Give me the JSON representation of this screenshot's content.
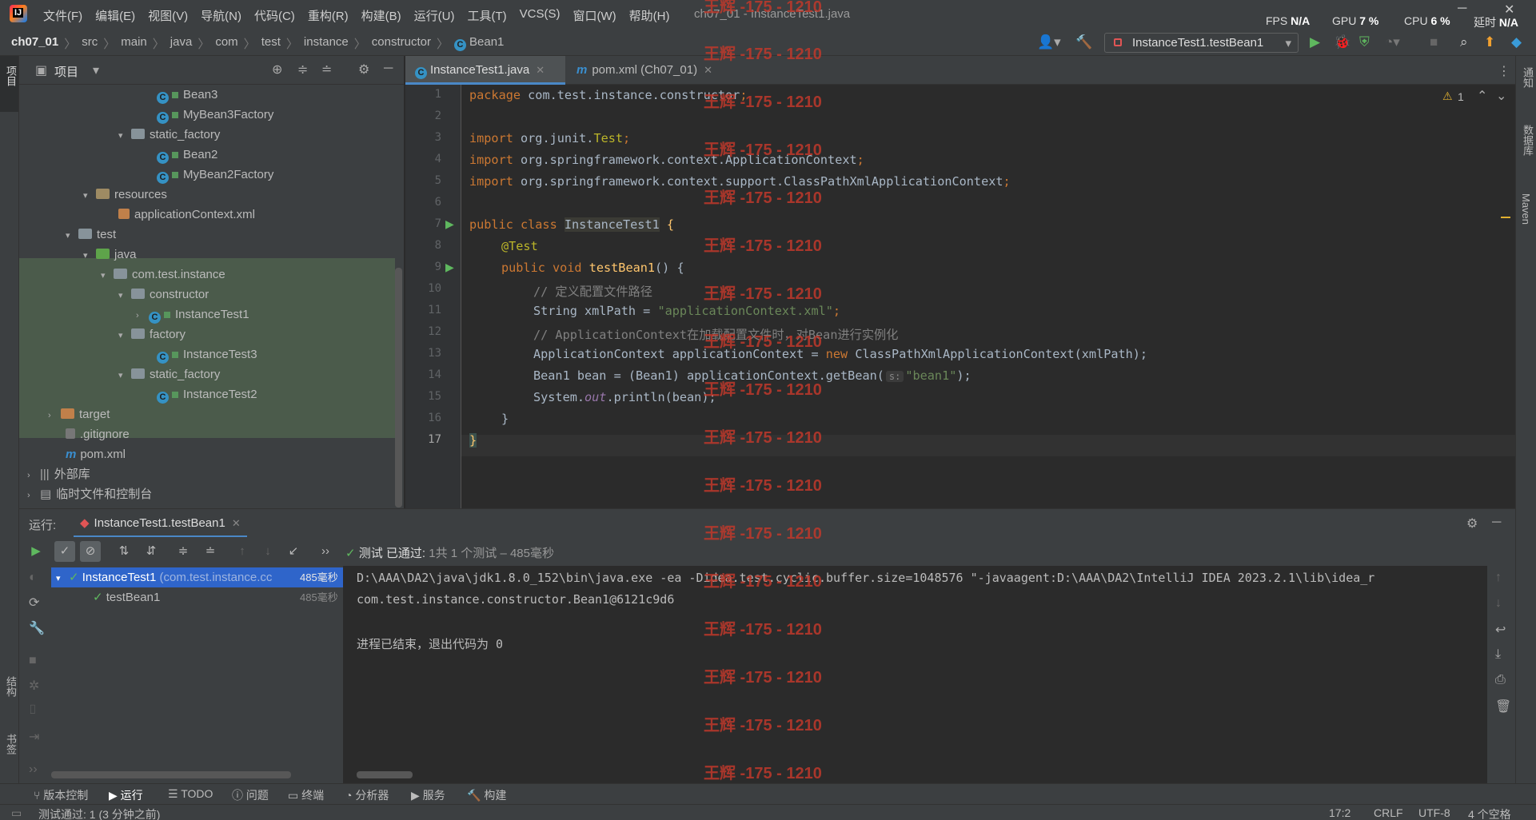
{
  "menu": [
    "文件(F)",
    "编辑(E)",
    "视图(V)",
    "导航(N)",
    "代码(C)",
    "重构(R)",
    "构建(B)",
    "运行(U)",
    "工具(T)",
    "VCS(S)",
    "窗口(W)",
    "帮助(H)"
  ],
  "window_title": "ch07_01 - InstanceTest1.java",
  "perf": {
    "fps_label": "FPS",
    "fps": "N/A",
    "gpu_label": "GPU",
    "gpu": "7 %",
    "cpu_label": "CPU",
    "cpu": "6 %",
    "latency_label": "延时",
    "latency": "N/A"
  },
  "breadcrumb": [
    "ch07_01",
    "src",
    "main",
    "java",
    "com",
    "test",
    "instance",
    "constructor",
    "Bean1"
  ],
  "run_config": "InstanceTest1.testBean1",
  "project_title": "项目",
  "tree": [
    {
      "label": "Bean3",
      "kind": "class"
    },
    {
      "label": "MyBean3Factory",
      "kind": "class"
    },
    {
      "label": "static_factory",
      "kind": "folder"
    },
    {
      "label": "Bean2",
      "kind": "class"
    },
    {
      "label": "MyBean2Factory",
      "kind": "class"
    },
    {
      "label": "resources",
      "kind": "folder"
    },
    {
      "label": "applicationContext.xml",
      "kind": "xml"
    },
    {
      "label": "test",
      "kind": "folder"
    },
    {
      "label": "java",
      "kind": "folder"
    },
    {
      "label": "com.test.instance",
      "kind": "folder"
    },
    {
      "label": "constructor",
      "kind": "folder"
    },
    {
      "label": "InstanceTest1",
      "kind": "class"
    },
    {
      "label": "factory",
      "kind": "folder"
    },
    {
      "label": "InstanceTest3",
      "kind": "class"
    },
    {
      "label": "static_factory",
      "kind": "folder"
    },
    {
      "label": "InstanceTest2",
      "kind": "class"
    },
    {
      "label": "target",
      "kind": "folder"
    },
    {
      "label": ".gitignore",
      "kind": "file"
    },
    {
      "label": "pom.xml",
      "kind": "file"
    },
    {
      "label": "外部库",
      "kind": "lib"
    },
    {
      "label": "临时文件和控制台",
      "kind": "lib"
    }
  ],
  "tabs": [
    {
      "label": "InstanceTest1.java",
      "active": true
    },
    {
      "label": "pom.xml (Ch07_01)",
      "active": false
    }
  ],
  "editor": {
    "warning_count": "1",
    "line_numbers": [
      "1",
      "2",
      "3",
      "4",
      "5",
      "6",
      "7",
      "8",
      "9",
      "10",
      "11",
      "12",
      "13",
      "14",
      "15",
      "16",
      "17"
    ],
    "code": {
      "l1a": "package ",
      "l1b": "com.test.instance.constructor",
      ";": ";",
      "l3a": "import ",
      "l3b": "org.junit.",
      "l3c": "Test",
      "l4a": "import ",
      "l4b": "org.springframework.context.ApplicationContext",
      "l5a": "import ",
      "l5b": "org.springframework.context.support.ClassPathXmlApplicationContext",
      "l7a": "public class ",
      "l7b": "InstanceTest1",
      " {": " {",
      "l8": "@Test",
      "l9a": "public void ",
      "l9b": "testBean1",
      "l9c": "() {",
      "l10": "// 定义配置文件路径",
      "l11a": "String xmlPath = ",
      "l11b": "\"applicationContext.xml\"",
      "l12": "// ApplicationContext在加载配置文件时，对Bean进行实例化",
      "l13a": "ApplicationContext applicationContext = ",
      "l13b": "new ",
      "l13c": "ClassPathXmlApplicationContext(xmlPath);",
      "l14a": "Bean1 bean = (Bean1) applicationContext.getBean(",
      "l14hint": "s:",
      "l14b": "\"bean1\"",
      "l14c": ");",
      "l15a": "System.",
      "l15b": "out",
      "l15c": ".println(bean);",
      "l16": "}",
      "l17": "}"
    }
  },
  "run": {
    "label": "运行:",
    "tab": "InstanceTest1.testBean1",
    "status_prefix": "测试 已通过:",
    "status_rest": "1共 1 个测试 – 485毫秒",
    "tree": [
      {
        "label": "InstanceTest1",
        "extra": "(com.test.instance.cc",
        "time": "485毫秒"
      },
      {
        "label": "testBean1",
        "extra": "",
        "time": "485毫秒"
      }
    ],
    "console": [
      "D:\\AAA\\DA2\\java\\jdk1.8.0_152\\bin\\java.exe -ea -Didea.test.cyclic.buffer.size=1048576 \"-javaagent:D:\\AAA\\DA2\\IntelliJ IDEA 2023.2.1\\lib\\idea_r",
      "com.test.instance.constructor.Bean1@6121c9d6",
      "",
      "进程已结束，退出代码为 0"
    ]
  },
  "bottom_tools": [
    "版本控制",
    "运行",
    "TODO",
    "问题",
    "终端",
    "分析器",
    "服务",
    "构建"
  ],
  "status": {
    "left": "测试通过: 1 (3 分钟之前)",
    "pos": "17:2",
    "eol": "CRLF",
    "enc": "UTF-8",
    "indent": "4 个空格"
  },
  "left_stripe": [
    "项目",
    "结构",
    "书签"
  ],
  "right_stripe": [
    "通知",
    "数据库",
    "Maven"
  ],
  "watermark": "王辉 -175 - 1210",
  "colors": {
    "bg": "#2b2b2b",
    "panel": "#3c3f41",
    "accent": "#4a88c7",
    "pass": "#5fb85f",
    "watermark": "#c0392b"
  }
}
